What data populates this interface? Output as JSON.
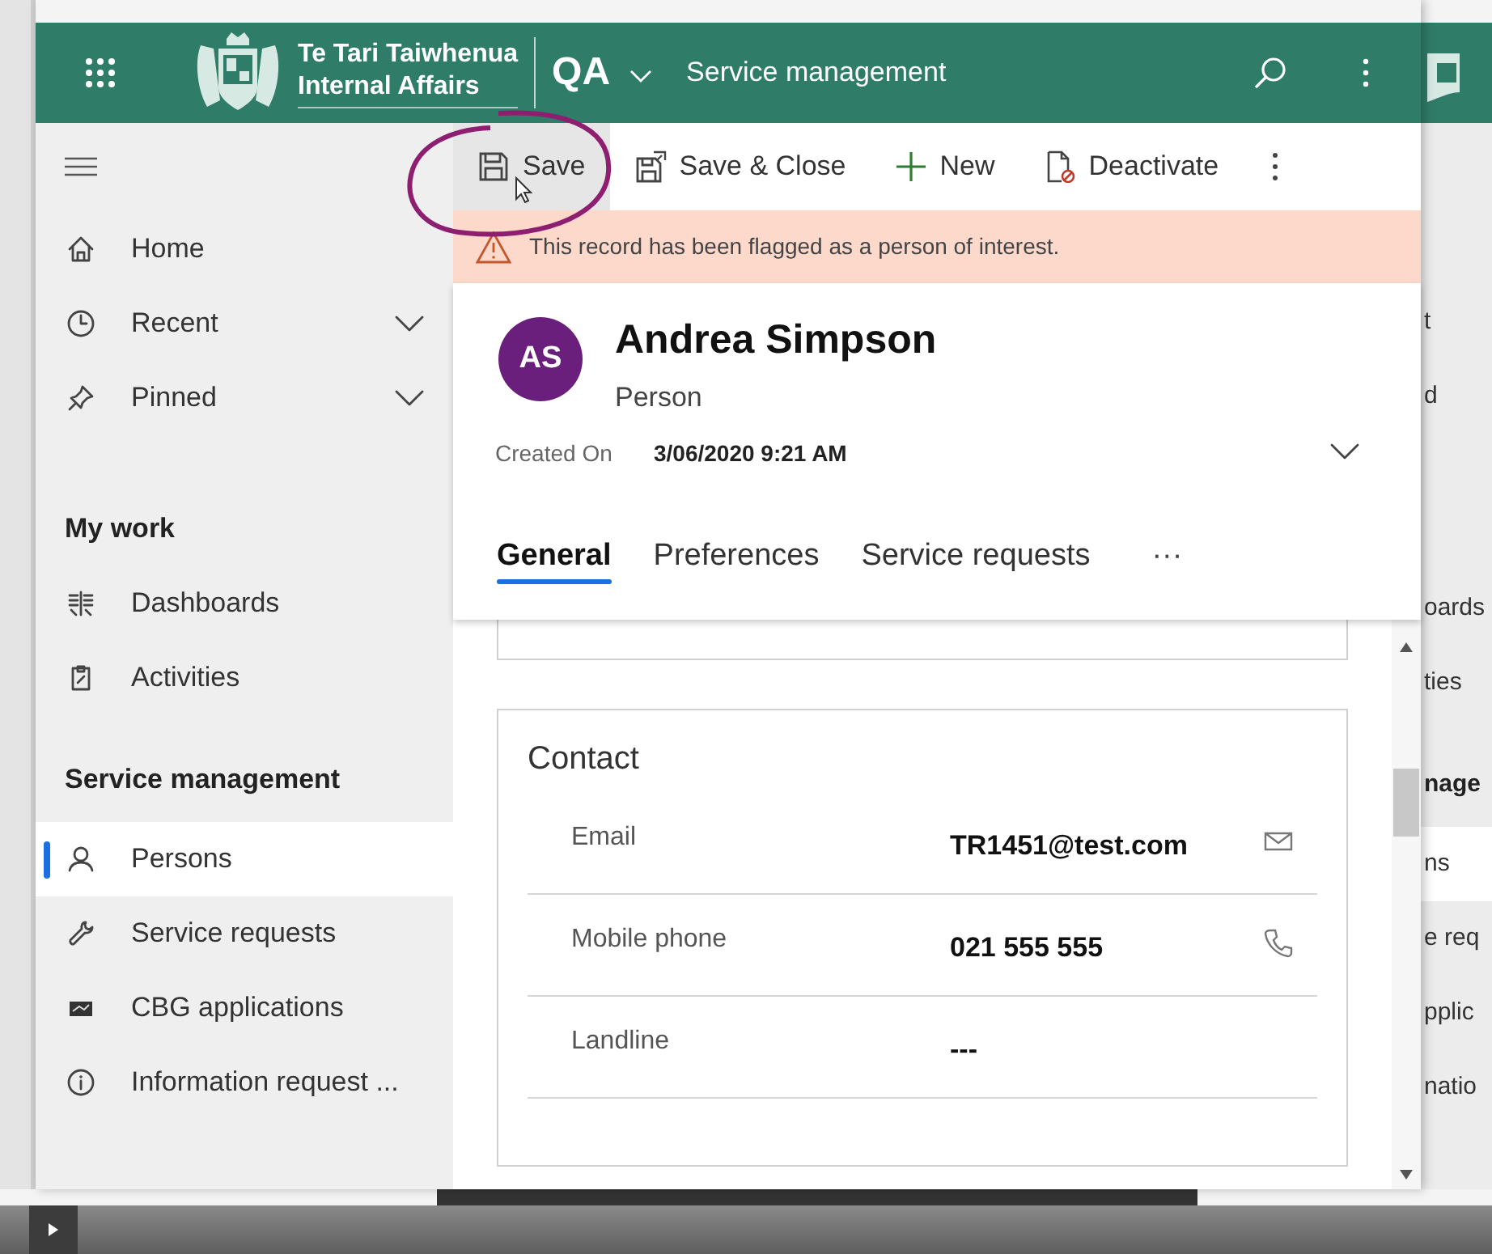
{
  "header": {
    "org_line1": "Te Tari Taiwhenua",
    "org_line2": "Internal Affairs",
    "environment": "QA",
    "app_name": "Service management"
  },
  "commands": [
    {
      "label": "Save",
      "kind": "save",
      "hovered": true
    },
    {
      "label": "Save & Close",
      "kind": "save-close",
      "hovered": false
    },
    {
      "label": "New",
      "kind": "new",
      "hovered": false
    },
    {
      "label": "Deactivate",
      "kind": "deactivate",
      "hovered": false
    }
  ],
  "sidebar": {
    "top_items": [
      {
        "label": "Home",
        "kind": "home"
      },
      {
        "label": "Recent",
        "kind": "recent",
        "expanded": false
      },
      {
        "label": "Pinned",
        "kind": "pinned",
        "expanded": false
      }
    ],
    "groups": [
      {
        "title": "My work",
        "items": [
          {
            "label": "Dashboards",
            "kind": "dashboards",
            "selected": false
          },
          {
            "label": "Activities",
            "kind": "activities",
            "selected": false
          }
        ]
      },
      {
        "title": "Service management",
        "items": [
          {
            "label": "Persons",
            "kind": "persons",
            "selected": true
          },
          {
            "label": "Service requests",
            "kind": "service-requests",
            "selected": false
          },
          {
            "label": "CBG applications",
            "kind": "cbg",
            "selected": false
          },
          {
            "label": "Information request ...",
            "kind": "information",
            "selected": false
          }
        ]
      }
    ]
  },
  "notification": {
    "text": "This record has been flagged as a person of interest."
  },
  "record": {
    "initials": "AS",
    "name": "Andrea Simpson",
    "entity": "Person",
    "created_label": "Created On",
    "created_value": "3/06/2020 9:21 AM"
  },
  "tabs": [
    {
      "label": "General",
      "selected": true
    },
    {
      "label": "Preferences",
      "selected": false
    },
    {
      "label": "Service requests",
      "selected": false
    }
  ],
  "tabs_overflow": "···",
  "section": {
    "title": "Contact",
    "fields": [
      {
        "label": "Email",
        "value": "TR1451@test.com",
        "kind": "email"
      },
      {
        "label": "Mobile phone",
        "value": "021 555 555",
        "kind": "phone"
      },
      {
        "label": "Landline",
        "value": "---",
        "kind": "text"
      }
    ]
  },
  "background_window": {
    "rows": [
      {
        "text": "t",
        "kind": "item",
        "selected": false
      },
      {
        "text": "d",
        "kind": "item",
        "selected": false
      },
      {
        "text": "oards",
        "kind": "item",
        "selected": false
      },
      {
        "text": "ties",
        "kind": "item",
        "selected": false
      },
      {
        "text": "nage",
        "kind": "heading",
        "selected": false
      },
      {
        "text": "ns",
        "kind": "item",
        "selected": true
      },
      {
        "text": "e req",
        "kind": "item",
        "selected": false
      },
      {
        "text": "pplic",
        "kind": "item",
        "selected": false
      },
      {
        "text": "natio",
        "kind": "item",
        "selected": false
      }
    ]
  }
}
